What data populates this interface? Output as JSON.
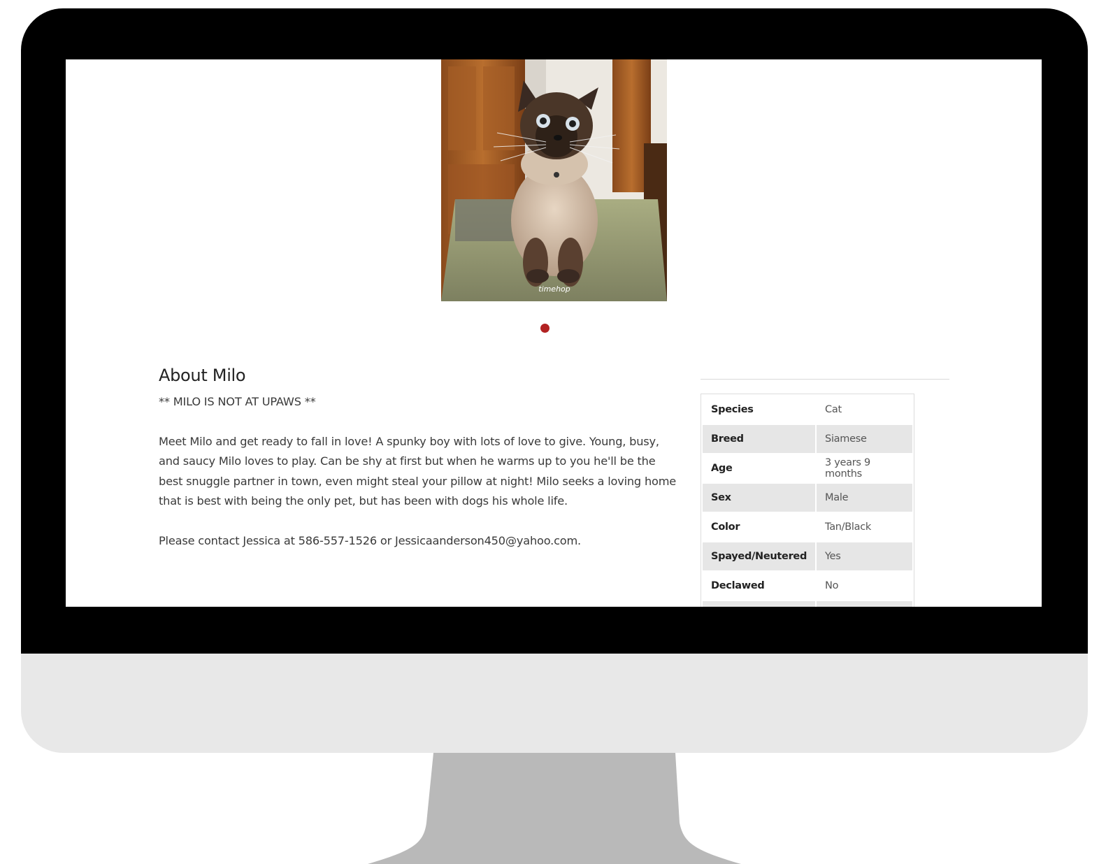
{
  "photo": {
    "alt": "Milo, a Siamese cat sitting on a green rug",
    "watermark": "timehop"
  },
  "carousel": {
    "active_color": "#b22222"
  },
  "about": {
    "title": "About Milo",
    "notice": "** MILO IS NOT AT UPAWS **",
    "description": "Meet Milo and get ready to fall in love! A spunky boy with lots of love to give. Young, busy, and saucy Milo loves to play. Can be shy at first but when he warms up to you he'll be the best snuggle partner in town, even might steal your pillow at night! Milo seeks a loving home that is best with being the only pet, but has been with dogs his whole life.",
    "contact": "Please contact Jessica at 586-557-1526 or Jessicaanderson450@yahoo.com."
  },
  "details": [
    {
      "label": "Species",
      "value": "Cat"
    },
    {
      "label": "Breed",
      "value": "Siamese"
    },
    {
      "label": "Age",
      "value": "3 years 9 months"
    },
    {
      "label": "Sex",
      "value": "Male"
    },
    {
      "label": "Color",
      "value": "Tan/Black"
    },
    {
      "label": "Spayed/Neutered",
      "value": "Yes"
    },
    {
      "label": "Declawed",
      "value": "No"
    }
  ],
  "colors": {
    "bezel": "#000000",
    "chin": "#e8e8e8",
    "stand": "#b9b9b9",
    "row_shade": "#e6e6e6",
    "accent": "#b22222"
  }
}
